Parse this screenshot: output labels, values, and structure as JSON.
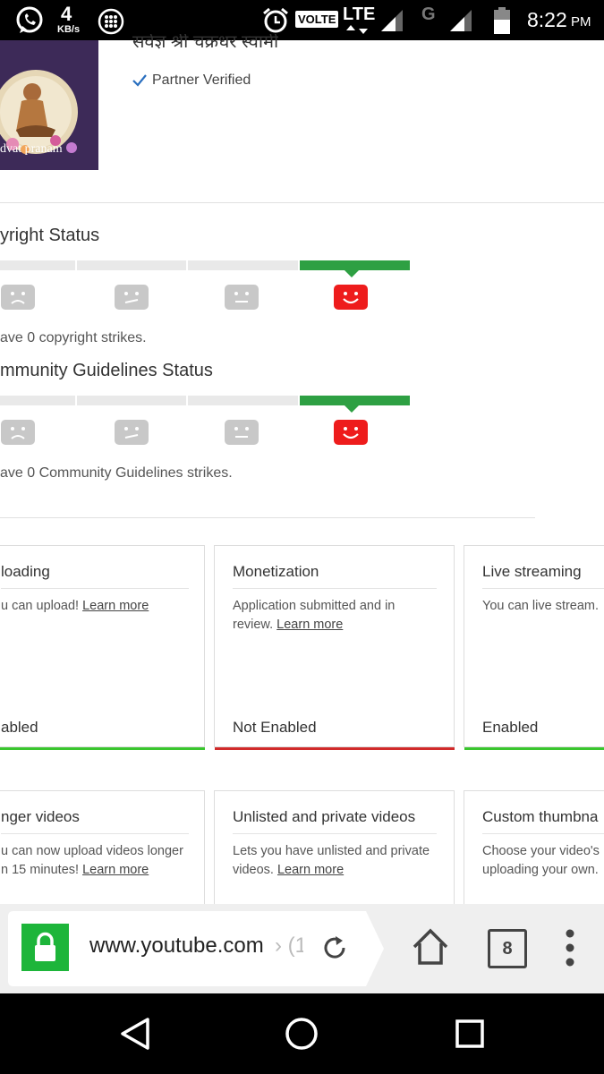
{
  "status_bar": {
    "speed_value": "4",
    "speed_unit": "KB/s",
    "volte": "VOLTE",
    "lte": "LTE",
    "g": "G",
    "time": "8:22",
    "ampm": "PM"
  },
  "channel": {
    "name": "सर्वज्ञ श्री चक्रधर स्वामी",
    "verified_label": "Partner Verified",
    "thumbnail_caption": "dvat pranam"
  },
  "copyright": {
    "title": "yright Status",
    "strikes_text": "ave 0 copyright strikes."
  },
  "guidelines": {
    "title": "mmunity Guidelines Status",
    "strikes_text": "ave 0 Community Guidelines strikes."
  },
  "features": [
    {
      "title": "loading",
      "desc": "u can upload! ",
      "link": "Learn more",
      "status": "abled"
    },
    {
      "title": "Monetization",
      "desc": "Application submitted and in review. ",
      "link": "Learn more",
      "status": "Not Enabled"
    },
    {
      "title": "Live streaming",
      "desc": "You can live stream.",
      "link": "",
      "status": "Enabled"
    },
    {
      "title": "nger videos",
      "desc_line1": "u can now upload videos longer",
      "desc_line2": "n 15 minutes! ",
      "link": "Learn more"
    },
    {
      "title": "Unlisted and private videos",
      "desc_line1": "Lets you have unlisted and private",
      "desc_line2": "videos. ",
      "link": "Learn more"
    },
    {
      "title": "Custom thumbna",
      "desc_line1": "Choose your video's",
      "desc_line2": "uploading your own."
    }
  ],
  "browser": {
    "url": "www.youtube.com",
    "url_suffix": "› (1",
    "tab_count": "8"
  },
  "colors": {
    "green": "#2ea043",
    "red": "#ee1c1c",
    "lock_green": "#1db53a"
  }
}
